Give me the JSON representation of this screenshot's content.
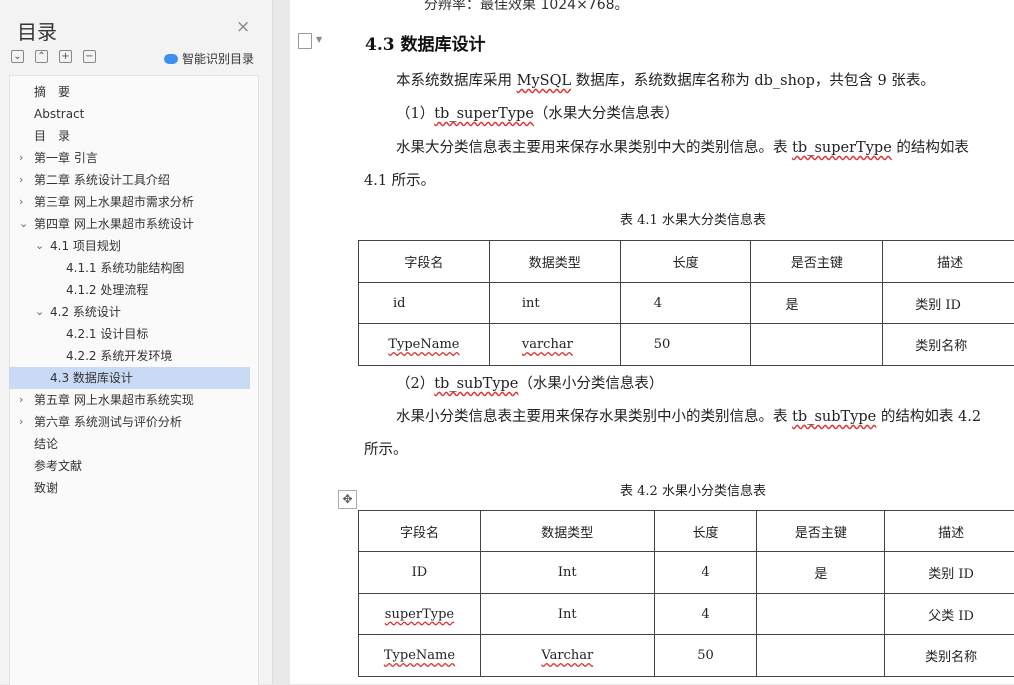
{
  "sidebar": {
    "title": "目录",
    "close_icon": "×",
    "ai_label": "智能识别目录",
    "toc": [
      {
        "label": "摘　要",
        "level": 0,
        "expander": ""
      },
      {
        "label": "Abstract",
        "level": 0,
        "expander": ""
      },
      {
        "label": "目　录",
        "level": 0,
        "expander": ""
      },
      {
        "label": "第一章 引言",
        "level": 0,
        "expander": "right"
      },
      {
        "label": "第二章 系统设计工具介绍",
        "level": 0,
        "expander": "right"
      },
      {
        "label": "第三章 网上水果超市需求分析",
        "level": 0,
        "expander": "right"
      },
      {
        "label": "第四章 网上水果超市系统设计",
        "level": 0,
        "expander": "down"
      },
      {
        "label": "4.1 项目规划",
        "level": 1,
        "expander": "down"
      },
      {
        "label": "4.1.1 系统功能结构图",
        "level": 2,
        "expander": ""
      },
      {
        "label": "4.1.2 处理流程",
        "level": 2,
        "expander": ""
      },
      {
        "label": "4.2 系统设计",
        "level": 1,
        "expander": "down"
      },
      {
        "label": "4.2.1 设计目标",
        "level": 2,
        "expander": ""
      },
      {
        "label": "4.2.2 系统开发环境",
        "level": 2,
        "expander": ""
      },
      {
        "label": "4.3 数据库设计",
        "level": 1,
        "expander": "",
        "selected": true
      },
      {
        "label": "第五章 网上水果超市系统实现",
        "level": 0,
        "expander": "right"
      },
      {
        "label": "第六章 系统测试与评价分析",
        "level": 0,
        "expander": "right"
      },
      {
        "label": "结论",
        "level": 0,
        "expander": ""
      },
      {
        "label": "参考文献",
        "level": 0,
        "expander": ""
      },
      {
        "label": "致谢",
        "level": 0,
        "expander": ""
      }
    ]
  },
  "doc": {
    "top_cut": "分辨率：最佳效果 1024×768。",
    "heading": "4.3  数据库设计",
    "p1": "本系统数据库采用 MySQL 数据库，系统数据库名称为 db_shop，共包含 9 张表。",
    "p2": "（1）tb_superType（水果大分类信息表）",
    "p3a": "水果大分类信息表主要用来保存水果类别中大的类别信息。表 tb_superType 的结构如表",
    "p3b": "4.1 所示。",
    "caption1": "表 4.1  水果大分类信息表",
    "table1": {
      "headers": [
        "字段名",
        "数据类型",
        "长度",
        "是否主键",
        "描述"
      ],
      "rows": [
        [
          "id",
          "int",
          "4",
          "是",
          "类别 ID"
        ],
        [
          "TypeName",
          "varchar",
          "50",
          "",
          "类别名称"
        ]
      ]
    },
    "p4": "（2）tb_subType（水果小分类信息表）",
    "p5a": "水果小分类信息表主要用来保存水果类别中小的类别信息。表 tb_subType 的结构如表 4.2",
    "p5b": "所示。",
    "caption2": "表 4.2  水果小分类信息表",
    "table2": {
      "headers": [
        "字段名",
        "数据类型",
        "长度",
        "是否主键",
        "描述"
      ],
      "rows": [
        [
          "ID",
          "Int",
          "4",
          "是",
          "类别 ID"
        ],
        [
          "superType",
          "Int",
          "4",
          "",
          "父类 ID"
        ],
        [
          "TypeName",
          "Varchar",
          "50",
          "",
          "类别名称"
        ]
      ]
    }
  }
}
